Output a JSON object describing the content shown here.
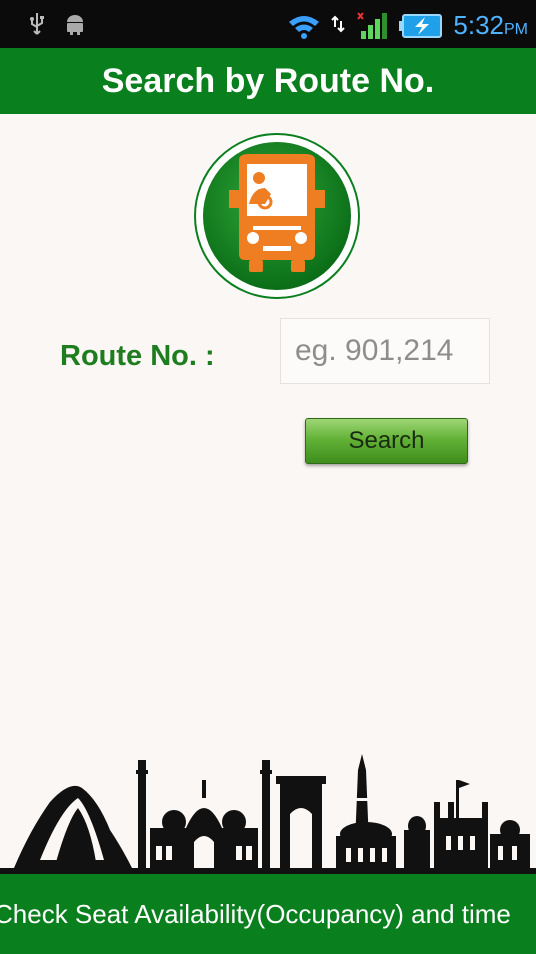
{
  "status_bar": {
    "time": "5:32",
    "ampm": "PM",
    "icons": [
      "usb-icon",
      "android-icon",
      "wifi-icon",
      "data-arrows-icon",
      "signal-icon",
      "battery-charging-icon"
    ]
  },
  "header": {
    "title": "Search by Route No."
  },
  "form": {
    "route_label": "Route No. :",
    "route_placeholder": "eg. 901,214",
    "route_value": "",
    "search_label": "Search"
  },
  "footer": {
    "ticker_text": "Check Seat Availability(Occupancy) and time"
  },
  "colors": {
    "primary_green": "#0a7f1e",
    "label_green": "#1e7d1f",
    "bus_orange": "#ef7d22",
    "status_blue": "#4fb3ff",
    "background": "#fbf7f4"
  }
}
